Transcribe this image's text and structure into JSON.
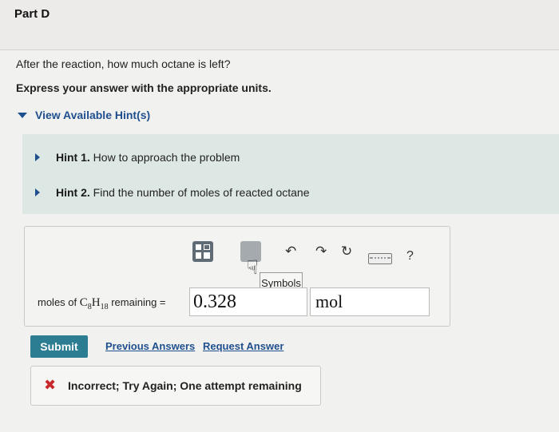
{
  "part_title": "Part D",
  "question": "After the reaction, how much octane is left?",
  "instruction": "Express your answer with the appropriate units.",
  "hints": {
    "toggle_label": "View Available Hint(s)",
    "items": [
      {
        "num": "Hint 1.",
        "text": "How to approach the problem"
      },
      {
        "num": "Hint 2.",
        "text": "Find the number of moles of reacted octane"
      }
    ]
  },
  "toolbar": {
    "templates_icon": "templates-icon",
    "symbols_tooltip": "Symbols",
    "undo_icon": "↶",
    "redo_icon": "↷",
    "reset_icon": "↻",
    "keyboard_icon": "keyboard-icon",
    "help_label": "?"
  },
  "answer": {
    "label_prefix": "moles of ",
    "formula_c": "C",
    "formula_c_sub": "8",
    "formula_h": "H",
    "formula_h_sub": "18",
    "label_suffix": " remaining =",
    "value": "0.328",
    "unit": "mol"
  },
  "actions": {
    "submit": "Submit",
    "previous_answers": "Previous Answers",
    "request_answer": "Request Answer"
  },
  "feedback": {
    "icon": "✖",
    "text": "Incorrect; Try Again; One attempt remaining"
  },
  "colors": {
    "submit_bg": "#2c7d92",
    "link": "#1f4f8f",
    "error_x": "#c8282a",
    "hint_panel_bg": "#dde8e4"
  }
}
